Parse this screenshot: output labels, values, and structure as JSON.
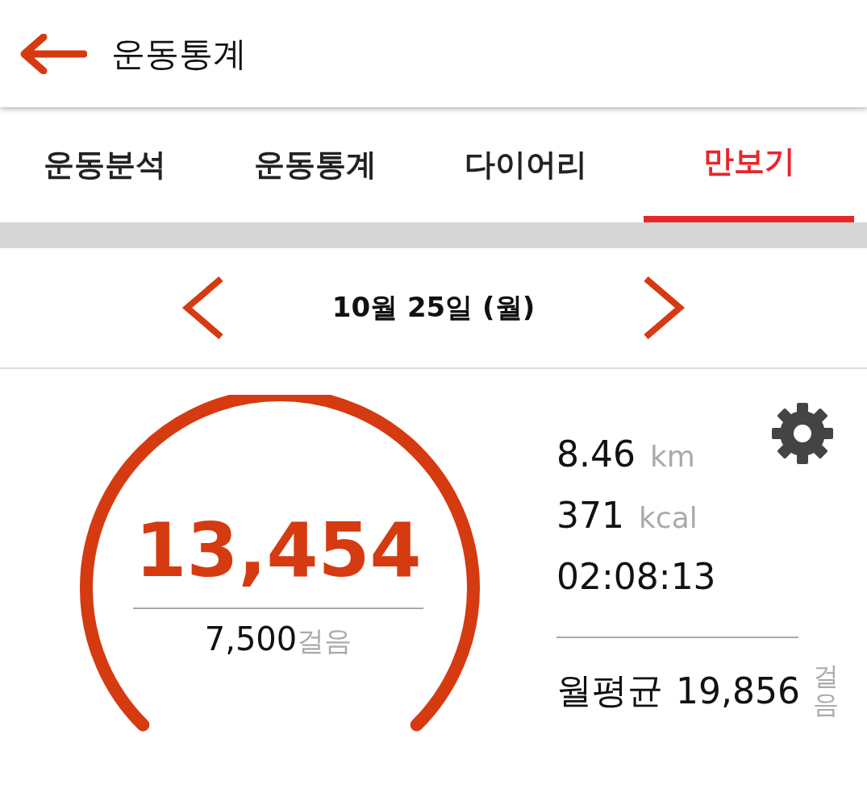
{
  "header": {
    "title": "운동통계"
  },
  "tabs": [
    {
      "label": "운동분석",
      "selected": false
    },
    {
      "label": "운동통계",
      "selected": false
    },
    {
      "label": "다이어리",
      "selected": false
    },
    {
      "label": "만보기",
      "selected": true
    }
  ],
  "date": "10월 25일 (월)",
  "gauge": {
    "steps": "13,454",
    "goal": "7,500",
    "goal_unit": "걸음"
  },
  "stats": [
    {
      "value": "8.46",
      "unit": "km"
    },
    {
      "value": "371",
      "unit": "kcal"
    },
    {
      "value": "02:08:13"
    }
  ],
  "monthly": {
    "label": "월평균",
    "value": "19,856",
    "unit": "걸음"
  }
}
